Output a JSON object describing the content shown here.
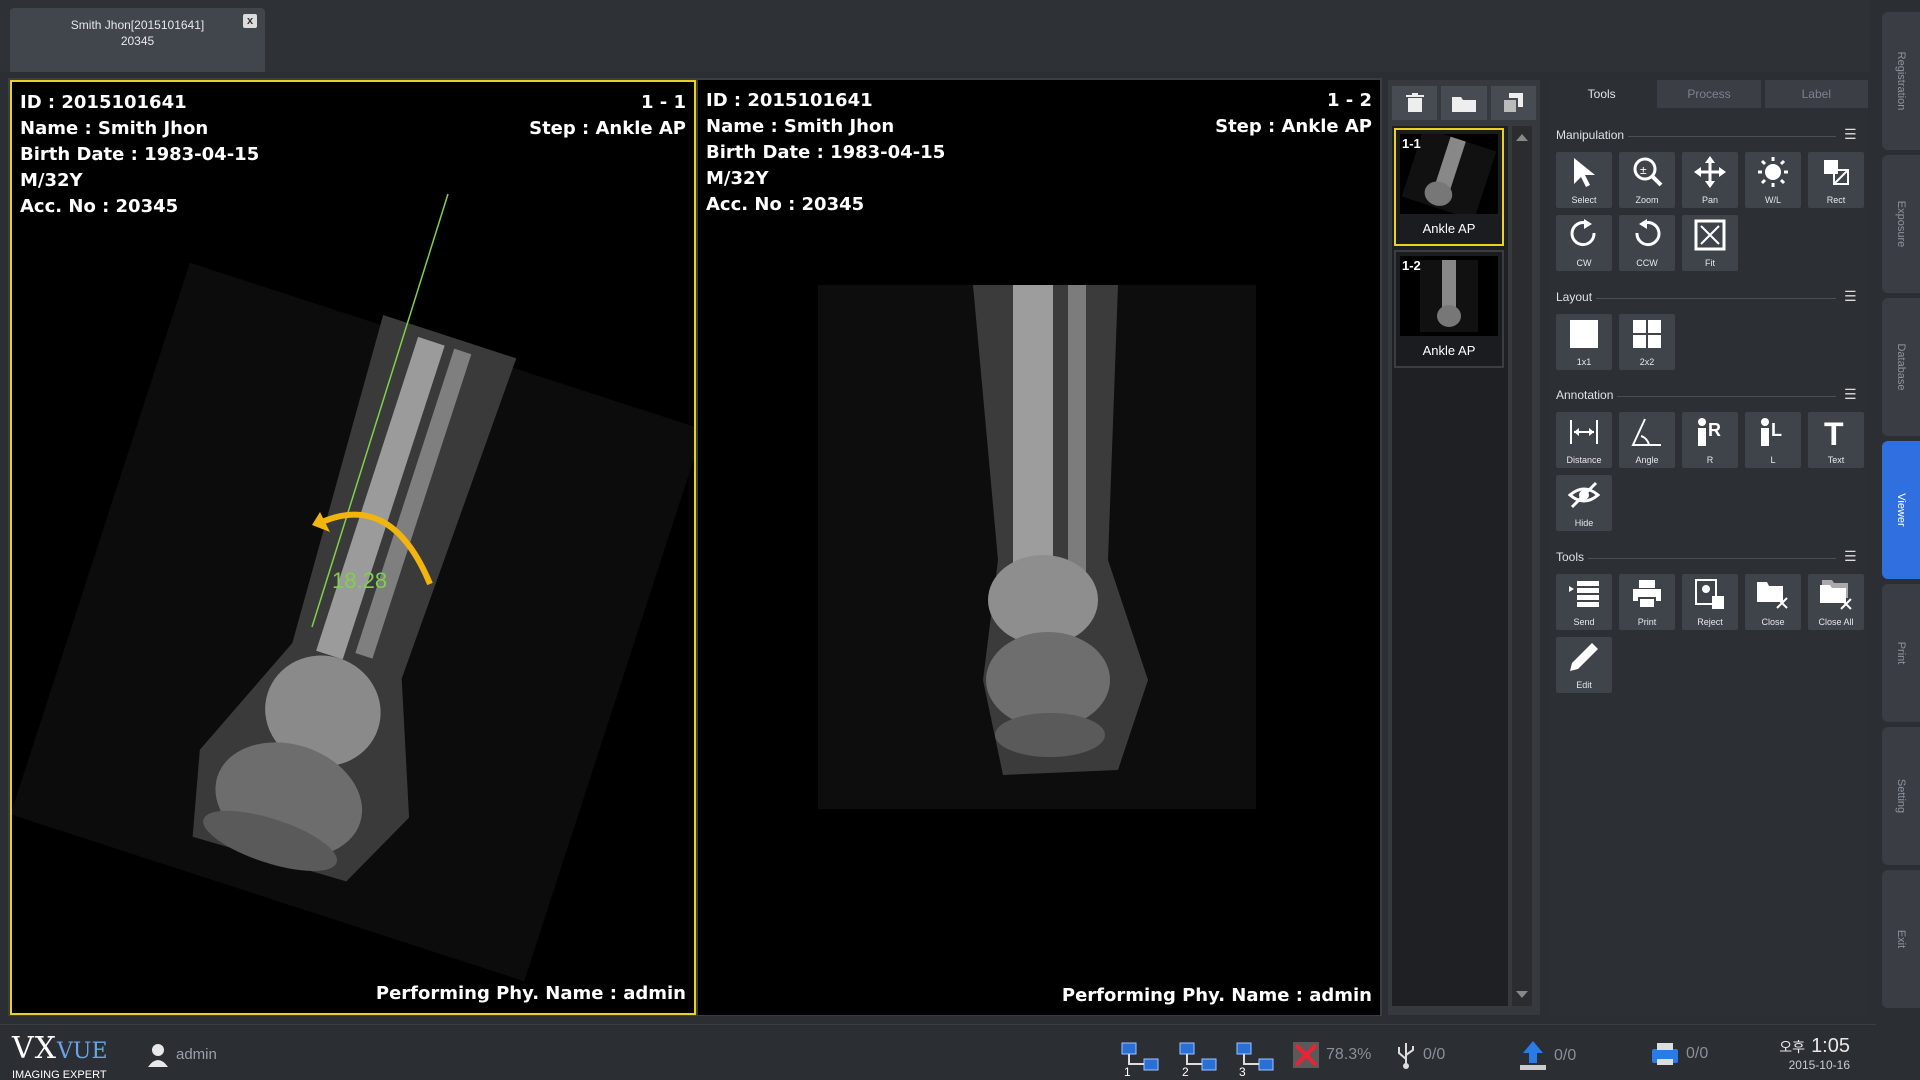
{
  "patient_tab": {
    "line1": "Smith Jhon[2015101641]",
    "line2": "20345",
    "close": "x"
  },
  "viewport1": {
    "id": "ID : 2015101641",
    "name": "Name : Smith Jhon",
    "birth": "Birth Date : 1983-04-15",
    "sex_age": "M/32Y",
    "acc": "Acc. No : 20345",
    "index": "1 - 1",
    "step": "Step : Ankle AP",
    "performing": "Performing Phy. Name : admin",
    "angle": "18.28"
  },
  "viewport2": {
    "id": "ID : 2015101641",
    "name": "Name : Smith Jhon",
    "birth": "Birth Date : 1983-04-15",
    "sex_age": "M/32Y",
    "acc": "Acc. No : 20345",
    "index": "1 - 2",
    "step": "Step : Ankle AP",
    "performing": "Performing Phy. Name : admin"
  },
  "thumbnails": [
    {
      "num": "1-1",
      "label": "Ankle AP"
    },
    {
      "num": "1-2",
      "label": "Ankle AP"
    }
  ],
  "tool_tabs": [
    "Tools",
    "Process",
    "Label"
  ],
  "sections": {
    "manipulation": {
      "title": "Manipulation",
      "tools": [
        "Select",
        "Zoom",
        "Pan",
        "W/L",
        "Rect",
        "CW",
        "CCW",
        "Fit"
      ]
    },
    "layout": {
      "title": "Layout",
      "tools": [
        "1x1",
        "2x2"
      ]
    },
    "annotation": {
      "title": "Annotation",
      "tools": [
        "Distance",
        "Angle",
        "R",
        "L",
        "Text",
        "Hide"
      ]
    },
    "tools": {
      "title": "Tools",
      "tools": [
        "Send",
        "Print",
        "Reject",
        "Close",
        "Close All",
        "Edit"
      ]
    }
  },
  "side_menu": [
    "Registration",
    "Exposure",
    "Database",
    "Viewer",
    "Print",
    "Setting",
    "Exit"
  ],
  "status": {
    "logo_main": "VX",
    "logo_vue": "VUE",
    "logo_sub": "IMAGING EXPERT",
    "user": "admin",
    "net1": "1",
    "net2": "2",
    "net3": "3",
    "disk": "78.3%",
    "usb": "0/0",
    "upload": "0/0",
    "print": "0/0",
    "ampm": "오후",
    "time": "1:05",
    "date": "2015-10-16"
  },
  "colors": {
    "accent": "#e8d21d",
    "active_side": "#2f6fe0",
    "measure": "#7fd14a",
    "arrow": "#f2b50d"
  }
}
